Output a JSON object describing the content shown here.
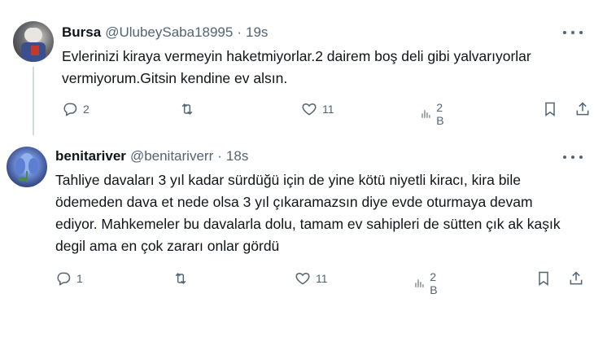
{
  "tweets": [
    {
      "name": "Bursa",
      "handle": "@UlubeySaba18995",
      "separator": "·",
      "time": "19s",
      "text": "Evlerinizi kiraya vermeyin haketmiyorlar.2 dairem boş deli gibi yalvarıyorlar vermiyorum.Gitsin kendine ev alsın.",
      "replies": "2",
      "retweets": "",
      "likes": "11",
      "views": "2 B"
    },
    {
      "name": "benitariver",
      "handle": "@benitariverr",
      "separator": "·",
      "time": "18s",
      "text": "Tahliye davaları 3 yıl kadar sürdüğü için de yine kötü niyetli kiracı, kira bile ödemeden dava et nede olsa 3 yıl çıkaramazsın diye evde oturmaya devam ediyor. Mahkemeler bu davalarla dolu, tamam ev sahipleri de sütten çık ak kaşık degil ama en çok zararı onlar gördü",
      "replies": "1",
      "retweets": "",
      "likes": "11",
      "views": "2 B"
    }
  ],
  "icons": {
    "reply": "reply-icon",
    "retweet": "retweet-icon",
    "like": "heart-icon",
    "views": "views-chart-icon",
    "bookmark": "bookmark-icon",
    "share": "share-icon",
    "more": "more-options-icon"
  },
  "colors": {
    "text": "#0f1419",
    "secondary": "#536471",
    "thread_line": "#cfd9de"
  }
}
